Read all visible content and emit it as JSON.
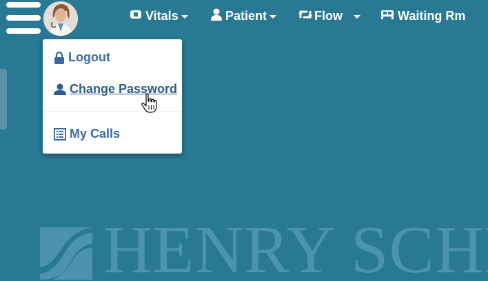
{
  "topnav": {
    "items": [
      {
        "label": "Vitals",
        "icon": "bandage-icon",
        "has_caret": true
      },
      {
        "label": "Patient",
        "icon": "user-icon",
        "has_caret": true
      },
      {
        "label": "Flow",
        "icon": "retweet-icon",
        "has_caret": true
      },
      {
        "label": "Waiting Rm",
        "icon": "bed-icon",
        "has_caret": false
      }
    ]
  },
  "user_menu": {
    "items": [
      {
        "label": "Logout",
        "icon": "lock-icon"
      },
      {
        "label": "Change Password",
        "icon": "user-icon",
        "state": "hover"
      },
      {
        "label": "My Calls",
        "icon": "list-icon"
      }
    ]
  },
  "watermark": {
    "text": "HENRY SCHE"
  },
  "colors": {
    "background": "#297994",
    "menu_text": "#3a6aa6",
    "watermark": "#4c93ae"
  }
}
